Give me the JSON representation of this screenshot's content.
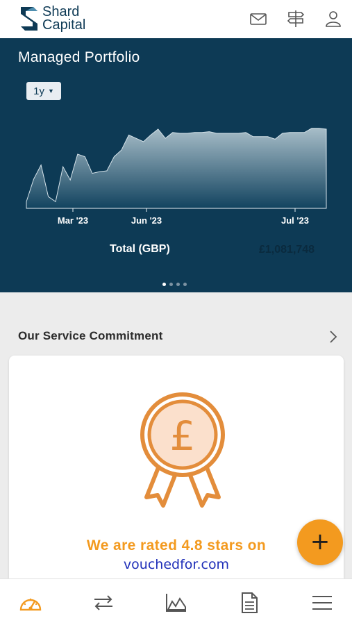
{
  "brand": {
    "line1": "Shard",
    "line2": "Capital"
  },
  "header_icons": [
    "mail-icon",
    "signpost-icon",
    "user-icon"
  ],
  "portfolio": {
    "title": "Managed Portfolio",
    "period": "1y",
    "total_label": "Total (GBP)",
    "total_value": "£1,081,748",
    "page_count": 4,
    "active_page": 1
  },
  "chart_data": {
    "type": "area",
    "x_ticks": [
      "Mar '23",
      "Jun '23",
      "Jul '23"
    ],
    "values": [
      8,
      35,
      52,
      14,
      8,
      50,
      34,
      65,
      62,
      42,
      44,
      45,
      62,
      70,
      88,
      84,
      80,
      88,
      95,
      84,
      91,
      90,
      90,
      91,
      91,
      92,
      90,
      90,
      90,
      90,
      91,
      86,
      86,
      86,
      83,
      90,
      91,
      91,
      91,
      96,
      96,
      95
    ],
    "grid": false,
    "colors": {
      "fill_top": "#a7bdc8",
      "fill_bottom": "#12435f",
      "line": "#d6e3ea"
    }
  },
  "service": {
    "title": "Our Service Commitment",
    "rating_text": "We are rated 4.8 stars on",
    "link_text": "vouchedfor.com",
    "badge_symbol": "£"
  },
  "fab": {
    "label": "+"
  },
  "bottom_nav": [
    "dashboard-icon",
    "transfer-icon",
    "chart-icon",
    "document-icon",
    "menu-icon"
  ],
  "colors": {
    "navy": "#0d3a55",
    "accent": "#f39a1f",
    "link": "#1f2fb8"
  }
}
